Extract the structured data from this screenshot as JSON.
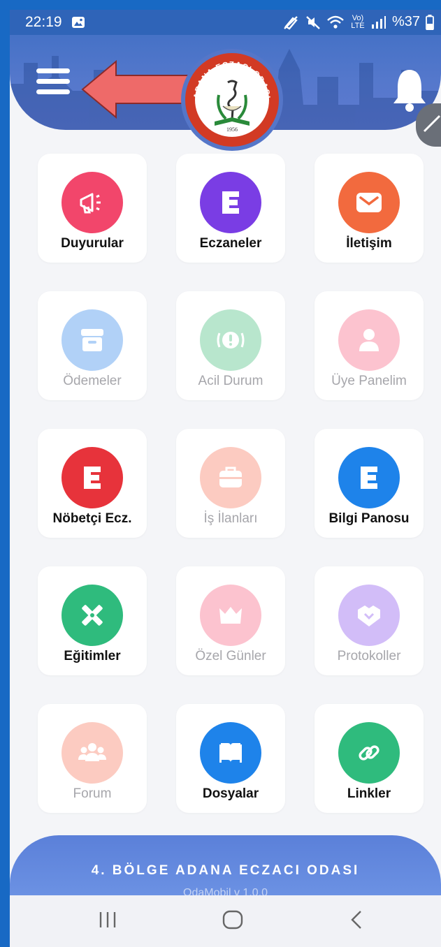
{
  "status_bar": {
    "time": "22:19",
    "network": "Vo) LTE",
    "battery": "%37"
  },
  "header": {
    "logo_text": "ADANA ECZACI ODASI",
    "logo_year": "1956"
  },
  "tiles": [
    {
      "label": "Duyurular",
      "icon": "megaphone-icon",
      "color": "#f2466b",
      "enabled": true
    },
    {
      "label": "Eczaneler",
      "icon": "e-letter-icon",
      "color": "#7a3de4",
      "enabled": true
    },
    {
      "label": "İletişim",
      "icon": "envelope-icon",
      "color": "#f26a3e",
      "enabled": true
    },
    {
      "label": "Ödemeler",
      "icon": "archive-box-icon",
      "color": "#b1d1f7",
      "enabled": false
    },
    {
      "label": "Acil Durum",
      "icon": "alert-icon",
      "color": "#b8e6cd",
      "enabled": false
    },
    {
      "label": "Üye Panelim",
      "icon": "user-icon",
      "color": "#fcc3cf",
      "enabled": false
    },
    {
      "label": "Nöbetçi Ecz.",
      "icon": "e-letter-icon",
      "color": "#e7333b",
      "enabled": true
    },
    {
      "label": "İş İlanları",
      "icon": "briefcase-icon",
      "color": "#fccbc1",
      "enabled": false
    },
    {
      "label": "Bilgi Panosu",
      "icon": "e-letter-icon",
      "color": "#1e83ea",
      "enabled": true
    },
    {
      "label": "Eğitimler",
      "icon": "pencil-ruler-icon",
      "color": "#2fbb7d",
      "enabled": true
    },
    {
      "label": "Özel Günler",
      "icon": "crown-icon",
      "color": "#fcc3cf",
      "enabled": false
    },
    {
      "label": "Protokoller",
      "icon": "handshake-icon",
      "color": "#d2bdf8",
      "enabled": false
    },
    {
      "label": "Forum",
      "icon": "users-icon",
      "color": "#fccbc1",
      "enabled": false
    },
    {
      "label": "Dosyalar",
      "icon": "book-icon",
      "color": "#1e83ea",
      "enabled": true
    },
    {
      "label": "Linkler",
      "icon": "link-icon",
      "color": "#2fbb7d",
      "enabled": true
    }
  ],
  "footer": {
    "title": "4. BÖLGE ADANA ECZACI ODASI",
    "version": "OdaMobil v 1.0.0"
  }
}
